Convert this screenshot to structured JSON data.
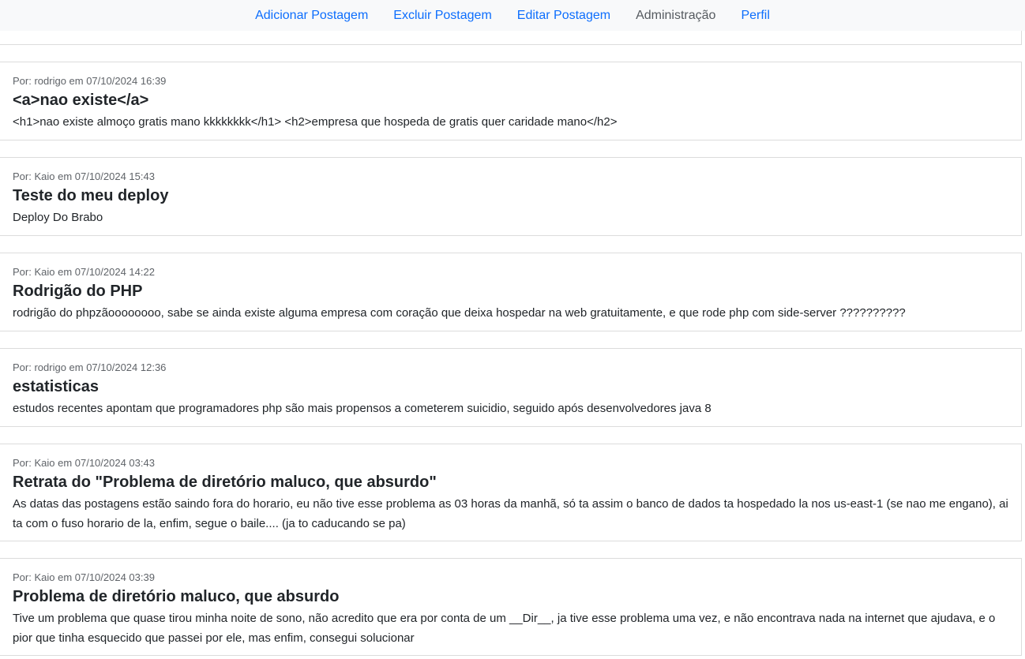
{
  "nav": {
    "items": [
      {
        "label": "Adicionar Postagem"
      },
      {
        "label": "Excluir Postagem"
      },
      {
        "label": "Editar Postagem"
      },
      {
        "label": "Administração"
      },
      {
        "label": "Perfil"
      }
    ]
  },
  "posts": [
    {
      "meta": "Por: rodrigo em 07/10/2024 16:39",
      "title": "<a>nao existe</a>",
      "body": "<h1>nao existe almoço gratis mano kkkkkkkk</h1> <h2>empresa que hospeda de gratis quer caridade mano</h2>"
    },
    {
      "meta": "Por: Kaio em 07/10/2024 15:43",
      "title": "Teste do meu deploy",
      "body": "Deploy Do Brabo"
    },
    {
      "meta": "Por: Kaio em 07/10/2024 14:22",
      "title": "Rodrigão do PHP",
      "body": "rodrigão do phpzãoooooooo, sabe se ainda existe alguma empresa com coração que deixa hospedar na web gratuitamente, e que rode php com side-server ??????????"
    },
    {
      "meta": "Por: rodrigo em 07/10/2024 12:36",
      "title": "estatisticas",
      "body": "estudos recentes apontam que programadores php são mais propensos a cometerem suicidio, seguido após desenvolvedores java 8"
    },
    {
      "meta": "Por: Kaio em 07/10/2024 03:43",
      "title": "Retrata do \"Problema de diretório maluco, que absurdo\"",
      "body": "As datas das postagens estão saindo fora do horario, eu não tive esse problema as 03 horas da manhã, só ta assim o banco de dados ta hospedado la nos us-east-1 (se nao me engano), ai ta com o fuso horario de la, enfim, segue o baile.... (ja to caducando se pa)"
    },
    {
      "meta": "Por: Kaio em 07/10/2024 03:39",
      "title": "Problema de diretório maluco, que absurdo",
      "body": "Tive um problema que quase tirou minha noite de sono, não acredito que era por conta de um __Dir__, ja tive esse problema uma vez, e não encontrava nada na internet que ajudava, e o pior que tinha esquecido que passei por ele, mas enfim, consegui solucionar"
    }
  ]
}
